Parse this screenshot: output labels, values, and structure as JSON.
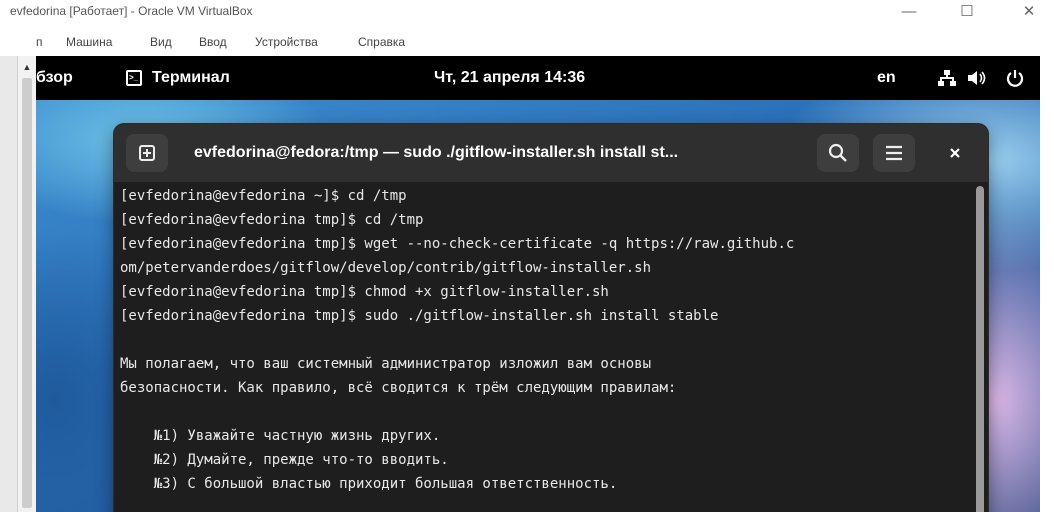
{
  "host_window": {
    "title": "evfedorina [Работает] - Oracle VM VirtualBox",
    "controls": {
      "minimize": "—",
      "maximize": "☐",
      "close": "✕"
    },
    "menu": [
      "п",
      "Машина",
      "Вид",
      "Ввод",
      "Устройства",
      "Справка"
    ]
  },
  "topbar": {
    "overview": "бзор",
    "app_name": "Терминал",
    "clock": "Чт, 21 апреля  14:36",
    "language": "en",
    "icons": {
      "network": "network-icon",
      "volume": "volume-icon",
      "power": "power-icon"
    }
  },
  "terminal": {
    "title": "evfedorina@fedora:/tmp — sudo ./gitflow-installer.sh install st...",
    "buttons": {
      "new_tab": "⊞",
      "search": "search-icon",
      "menu": "hamburger-icon",
      "close": "×"
    },
    "lines": [
      "[evfedorina@evfedorina ~]$ cd /tmp",
      "[evfedorina@evfedorina tmp]$ cd /tmp",
      "[evfedorina@evfedorina tmp]$ wget --no-check-certificate -q https://raw.github.c",
      "om/petervanderdoes/gitflow/develop/contrib/gitflow-installer.sh",
      "[evfedorina@evfedorina tmp]$ chmod +x gitflow-installer.sh",
      "[evfedorina@evfedorina tmp]$ sudo ./gitflow-installer.sh install stable",
      "",
      "Мы полагаем, что ваш системный администратор изложил вам основы",
      "безопасности. Как правило, всё сводится к трём следующим правилам:",
      "",
      "    №1) Уважайте частную жизнь других.",
      "    №2) Думайте, прежде что-то вводить.",
      "    №3) С большой властью приходит большая ответственность."
    ]
  }
}
